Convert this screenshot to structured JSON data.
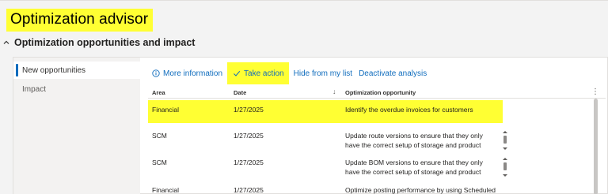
{
  "page": {
    "title": "Optimization advisor"
  },
  "section": {
    "title": "Optimization opportunities and impact"
  },
  "nav": {
    "items": [
      {
        "label": "New opportunities"
      },
      {
        "label": "Impact"
      }
    ]
  },
  "toolbar": {
    "more_info": "More information",
    "take_action": "Take action",
    "hide": "Hide from my list",
    "deactivate": "Deactivate analysis"
  },
  "grid": {
    "columns": [
      "Area",
      "Date",
      "Optimization opportunity"
    ],
    "rows": [
      {
        "area": "Financial",
        "date": "1/27/2025",
        "opportunity": [
          "Identify the overdue invoices for customers"
        ]
      },
      {
        "area": "SCM",
        "date": "1/27/2025",
        "opportunity": [
          "Update route versions to ensure that they only",
          "have the correct setup of storage and product"
        ]
      },
      {
        "area": "SCM",
        "date": "1/27/2025",
        "opportunity": [
          "Update BOM versions to ensure that they only",
          "have the correct setup of storage and product"
        ]
      },
      {
        "area": "Financial",
        "date": "1/27/2025",
        "opportunity": [
          "Optimize posting performance by using Scheduled"
        ]
      }
    ]
  },
  "colors": {
    "highlight": "#ffff33",
    "accent": "#0f6cbd"
  },
  "icons": [
    "chevron-up-icon",
    "info-icon",
    "checkmark-icon",
    "sort-down-icon",
    "more-vertical-icon"
  ]
}
